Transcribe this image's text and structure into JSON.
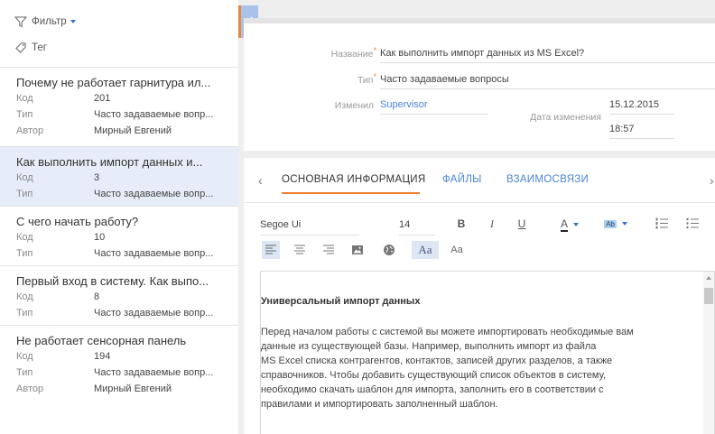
{
  "filter": {
    "label": "Фильтр"
  },
  "tag": {
    "label": "Тег"
  },
  "list": {
    "items": [
      {
        "title": "Почему не работает гарнитура ил...",
        "fields": [
          {
            "k": "Код",
            "v": "201"
          },
          {
            "k": "Тип",
            "v": "Часто задаваемые вопр..."
          },
          {
            "k": "Автор",
            "v": "Мирный Евгений"
          }
        ]
      },
      {
        "title": "Как выполнить импорт данных и...",
        "fields": [
          {
            "k": "Код",
            "v": "3"
          },
          {
            "k": "Тип",
            "v": "Часто задаваемые вопр..."
          }
        ]
      },
      {
        "title": "С чего начать работу?",
        "fields": [
          {
            "k": "Код",
            "v": "10"
          },
          {
            "k": "Тип",
            "v": "Часто задаваемые вопр..."
          }
        ]
      },
      {
        "title": "Первый вход в систему. Как выпо...",
        "fields": [
          {
            "k": "Код",
            "v": "8"
          },
          {
            "k": "Тип",
            "v": "Часто задаваемые вопр..."
          }
        ]
      },
      {
        "title": "Не работает сенсорная панель",
        "fields": [
          {
            "k": "Код",
            "v": "194"
          },
          {
            "k": "Тип",
            "v": "Часто задаваемые вопр..."
          },
          {
            "k": "Автор",
            "v": "Мирный Евгений"
          }
        ]
      }
    ]
  },
  "record": {
    "name_label": "Название",
    "name_value": "Как выполнить импорт данных из MS Excel?",
    "type_label": "Тип",
    "type_value": "Часто задаваемые вопросы",
    "modified_by_label": "Изменил",
    "modified_by_value": "Supervisor",
    "modified_date_label": "Дата изменения",
    "modified_date": "15.12.2015",
    "modified_time": "18:57"
  },
  "tabs": [
    {
      "label": "ОСНОВНАЯ ИНФОРМАЦИЯ",
      "active": true
    },
    {
      "label": "ФАЙЛЫ",
      "active": false
    },
    {
      "label": "ВЗАИМОСВЯЗИ",
      "active": false
    }
  ],
  "editor_toolbar": {
    "font_family": "Segoe Ui",
    "font_size": "14",
    "bold": "B",
    "italic": "I",
    "underline": "U",
    "font_color": "A",
    "highlight": "Ab",
    "case_upper": "Aa",
    "case_lower": "Aa"
  },
  "editor": {
    "title": "Универсальный импорт данных",
    "lines": [
      "Перед началом работы с системой вы можете импортировать необходимые вам",
      "данные из существующей базы. Например, выполнить импорт из файла",
      "MS Excel списка контрагентов, контактов, записей других разделов, а также",
      "справочников. Чтобы добавить существующий список объектов в систему,",
      "необходимо скачать шаблон для импорта, заполнить его в соответствии с",
      "правилами и импортировать заполненный шаблон."
    ]
  },
  "colors": {
    "accent": "#f08030",
    "link": "#4a83d9",
    "selected_row": "#e7edf8"
  }
}
